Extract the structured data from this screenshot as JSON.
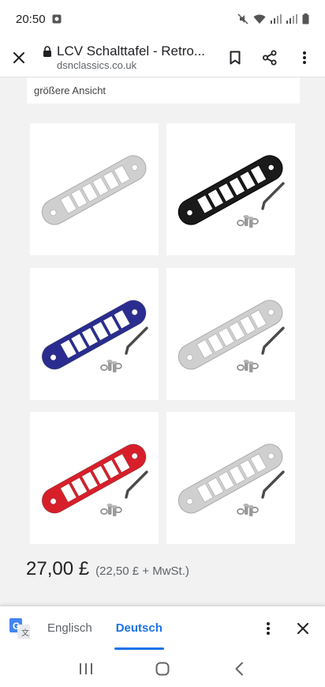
{
  "status_bar": {
    "time": "20:50"
  },
  "toolbar": {
    "title": "LCV Schalttafel - Retro...",
    "url": "dsnclassics.co.uk",
    "icons": [
      "close-icon",
      "lock-icon",
      "bookmark-icon",
      "share-icon",
      "more-vert-icon"
    ]
  },
  "page": {
    "caption": "größere Ansicht",
    "images": [
      {
        "color_name": "silver",
        "color": "#cfcfcf",
        "has_tool": false
      },
      {
        "color_name": "black",
        "color": "#1a1a1a",
        "has_tool": true
      },
      {
        "color_name": "blue",
        "color": "#2a2d8f",
        "has_tool": true
      },
      {
        "color_name": "silver",
        "color": "#cfcfcf",
        "has_tool": true
      },
      {
        "color_name": "red",
        "color": "#d71f2a",
        "has_tool": true
      },
      {
        "color_name": "silver",
        "color": "#cfcfcf",
        "has_tool": true
      }
    ],
    "price": "27,00 £",
    "price_note": "(22,50 £ + MwSt.)"
  },
  "translate_bar": {
    "lang_source": "Englisch",
    "lang_target": "Deutsch",
    "active_color": "#1a73e8"
  },
  "nav_bar": {
    "icons": [
      "recents-icon",
      "home-icon",
      "back-icon"
    ]
  }
}
